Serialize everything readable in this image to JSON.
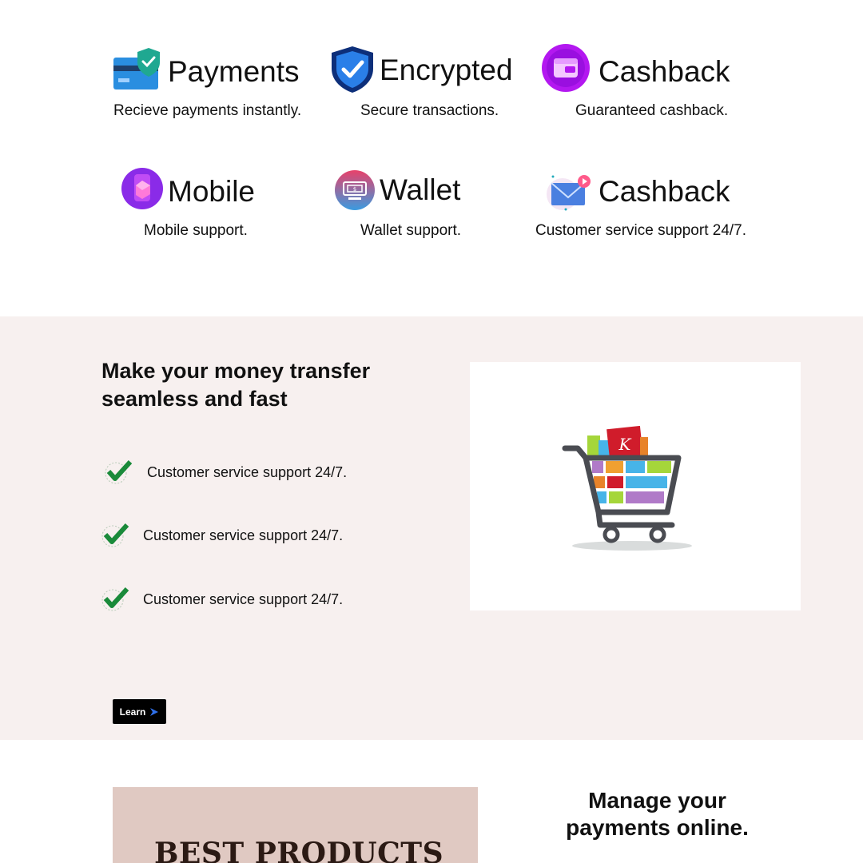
{
  "features": [
    {
      "title": "Payments",
      "desc": "Recieve payments instantly.",
      "icon": "card-shield-icon"
    },
    {
      "title": "Encrypted",
      "desc": "Secure transactions.",
      "icon": "shield-check-icon"
    },
    {
      "title": "Cashback",
      "desc": "Guaranteed cashback.",
      "icon": "wallet-icon"
    },
    {
      "title": "Mobile",
      "desc": "Mobile support.",
      "icon": "mobile-icon"
    },
    {
      "title": "Wallet",
      "desc": "Wallet support.",
      "icon": "atm-icon"
    },
    {
      "title": "Cashback",
      "desc": "Customer service support 24/7.",
      "icon": "mail-icon"
    }
  ],
  "transfer": {
    "heading": "Make your money transfer seamless and fast",
    "items": [
      "Customer service support 24/7.",
      "Customer service support 24/7.",
      "Customer service support 24/7."
    ],
    "image_icon": "shopping-cart-icon",
    "learn_label": "Learn"
  },
  "bottom": {
    "promo_text": "BEST PRODUCTS",
    "manage_text": "Manage your payments online."
  },
  "colors": {
    "band_bg": "#f7f0ef",
    "check_green": "#1a8a3a",
    "promo_bg": "#e0c9c2",
    "button_bg": "#000000"
  }
}
